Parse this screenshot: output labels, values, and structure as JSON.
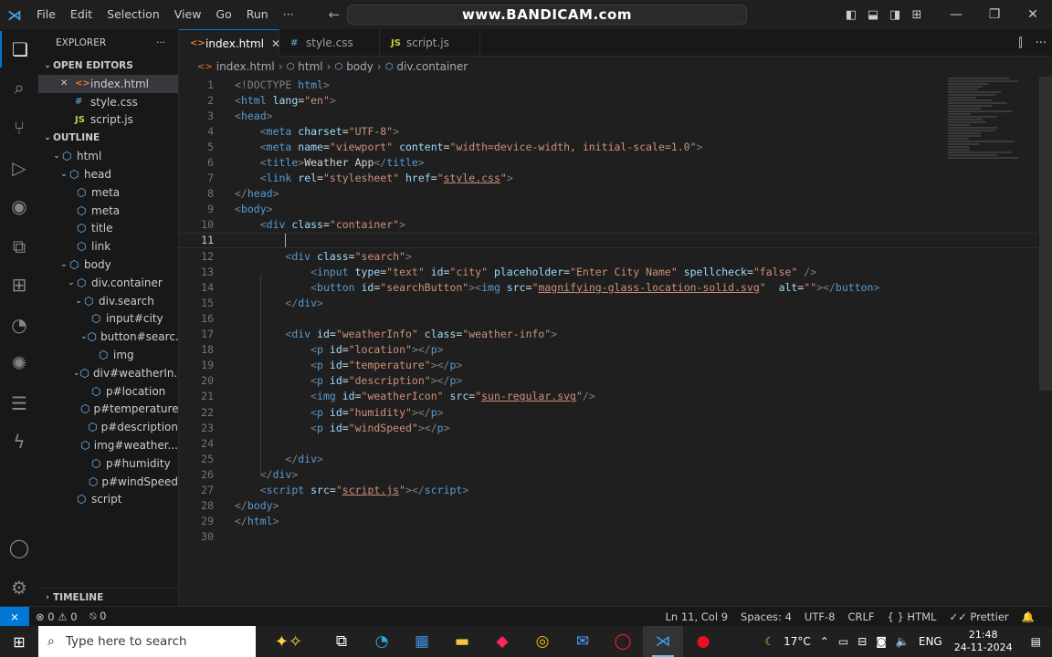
{
  "titlebar": {
    "menu": [
      "File",
      "Edit",
      "Selection",
      "View",
      "Go",
      "Run",
      "···"
    ],
    "search_text": "www.BANDICAM.com"
  },
  "sidebar": {
    "header": "EXPLORER",
    "more": "···",
    "open_editors_label": "OPEN EDITORS",
    "open_editors": [
      {
        "name": "index.html",
        "icon": "<>",
        "color": "#e37933",
        "selected": true
      },
      {
        "name": "style.css",
        "icon": "#",
        "color": "#519aba",
        "selected": false
      },
      {
        "name": "script.js",
        "icon": "JS",
        "color": "#cbcb41",
        "selected": false
      }
    ],
    "outline_label": "OUTLINE",
    "outline": [
      {
        "label": "html",
        "depth": 0,
        "chev": "v"
      },
      {
        "label": "head",
        "depth": 1,
        "chev": "v"
      },
      {
        "label": "meta",
        "depth": 2,
        "chev": ""
      },
      {
        "label": "meta",
        "depth": 2,
        "chev": ""
      },
      {
        "label": "title",
        "depth": 2,
        "chev": ""
      },
      {
        "label": "link",
        "depth": 2,
        "chev": ""
      },
      {
        "label": "body",
        "depth": 1,
        "chev": "v"
      },
      {
        "label": "div.container",
        "depth": 2,
        "chev": "v"
      },
      {
        "label": "div.search",
        "depth": 3,
        "chev": "v"
      },
      {
        "label": "input#city",
        "depth": 4,
        "chev": ""
      },
      {
        "label": "button#searc...",
        "depth": 4,
        "chev": "v"
      },
      {
        "label": "img",
        "depth": 5,
        "chev": ""
      },
      {
        "label": "div#weatherIn...",
        "depth": 3,
        "chev": "v"
      },
      {
        "label": "p#location",
        "depth": 4,
        "chev": ""
      },
      {
        "label": "p#temperature",
        "depth": 4,
        "chev": ""
      },
      {
        "label": "p#description",
        "depth": 4,
        "chev": ""
      },
      {
        "label": "img#weather...",
        "depth": 4,
        "chev": ""
      },
      {
        "label": "p#humidity",
        "depth": 4,
        "chev": ""
      },
      {
        "label": "p#windSpeed",
        "depth": 4,
        "chev": ""
      },
      {
        "label": "script",
        "depth": 2,
        "chev": ""
      }
    ],
    "timeline_label": "TIMELINE"
  },
  "tabs": [
    {
      "name": "index.html",
      "icon": "<>",
      "color": "#e37933",
      "active": true,
      "close": "✕"
    },
    {
      "name": "style.css",
      "icon": "#",
      "color": "#519aba",
      "active": false,
      "close": ""
    },
    {
      "name": "script.js",
      "icon": "JS",
      "color": "#cbcb41",
      "active": false,
      "close": ""
    }
  ],
  "breadcrumb": [
    "index.html",
    "html",
    "body",
    "div.container"
  ],
  "code_lines": [
    [
      [
        "tg",
        "<!DOCTYPE "
      ],
      [
        "tn",
        "html"
      ],
      [
        "tg",
        ">"
      ]
    ],
    [
      [
        "tg",
        "<"
      ],
      [
        "tn",
        "html"
      ],
      [
        "an",
        " lang"
      ],
      [
        "tx",
        "="
      ],
      [
        "av",
        "\"en\""
      ],
      [
        "tg",
        ">"
      ]
    ],
    [
      [
        "tg",
        "<"
      ],
      [
        "tn",
        "head"
      ],
      [
        "tg",
        ">"
      ]
    ],
    [
      [
        "tx",
        "    "
      ],
      [
        "tg",
        "<"
      ],
      [
        "tn",
        "meta"
      ],
      [
        "an",
        " charset"
      ],
      [
        "tx",
        "="
      ],
      [
        "av",
        "\"UTF-8\""
      ],
      [
        "tg",
        ">"
      ]
    ],
    [
      [
        "tx",
        "    "
      ],
      [
        "tg",
        "<"
      ],
      [
        "tn",
        "meta"
      ],
      [
        "an",
        " name"
      ],
      [
        "tx",
        "="
      ],
      [
        "av",
        "\"viewport\""
      ],
      [
        "an",
        " content"
      ],
      [
        "tx",
        "="
      ],
      [
        "av",
        "\"width=device-width, initial-scale=1.0\""
      ],
      [
        "tg",
        ">"
      ]
    ],
    [
      [
        "tx",
        "    "
      ],
      [
        "tg",
        "<"
      ],
      [
        "tn",
        "title"
      ],
      [
        "tg",
        ">"
      ],
      [
        "tx",
        "Weather App"
      ],
      [
        "tg",
        "</"
      ],
      [
        "tn",
        "title"
      ],
      [
        "tg",
        ">"
      ]
    ],
    [
      [
        "tx",
        "    "
      ],
      [
        "tg",
        "<"
      ],
      [
        "tn",
        "link"
      ],
      [
        "an",
        " rel"
      ],
      [
        "tx",
        "="
      ],
      [
        "av",
        "\"stylesheet\""
      ],
      [
        "an",
        " href"
      ],
      [
        "tx",
        "="
      ],
      [
        "av",
        "\""
      ],
      [
        "avu",
        "style.css"
      ],
      [
        "av",
        "\""
      ],
      [
        "tg",
        ">"
      ]
    ],
    [
      [
        "tg",
        "</"
      ],
      [
        "tn",
        "head"
      ],
      [
        "tg",
        ">"
      ]
    ],
    [
      [
        "tg",
        "<"
      ],
      [
        "tn",
        "body"
      ],
      [
        "tg",
        ">"
      ]
    ],
    [
      [
        "tx",
        "    "
      ],
      [
        "tg",
        "<"
      ],
      [
        "tn",
        "div"
      ],
      [
        "an",
        " class"
      ],
      [
        "tx",
        "="
      ],
      [
        "av",
        "\"container\""
      ],
      [
        "tg",
        ">"
      ]
    ],
    [
      [
        "tx",
        "        "
      ],
      [
        "cursor",
        ""
      ]
    ],
    [
      [
        "tx",
        "        "
      ],
      [
        "tg",
        "<"
      ],
      [
        "tn",
        "div"
      ],
      [
        "an",
        " class"
      ],
      [
        "tx",
        "="
      ],
      [
        "av",
        "\"search\""
      ],
      [
        "tg",
        ">"
      ]
    ],
    [
      [
        "tx",
        "            "
      ],
      [
        "tg",
        "<"
      ],
      [
        "tn",
        "input"
      ],
      [
        "an",
        " type"
      ],
      [
        "tx",
        "="
      ],
      [
        "av",
        "\"text\""
      ],
      [
        "an",
        " id"
      ],
      [
        "tx",
        "="
      ],
      [
        "av",
        "\"city\""
      ],
      [
        "an",
        " placeholder"
      ],
      [
        "tx",
        "="
      ],
      [
        "av",
        "\"Enter City Name\""
      ],
      [
        "an",
        " spellcheck"
      ],
      [
        "tx",
        "="
      ],
      [
        "av",
        "\"false\""
      ],
      [
        "tg",
        " />"
      ]
    ],
    [
      [
        "tx",
        "            "
      ],
      [
        "tg",
        "<"
      ],
      [
        "tn",
        "button"
      ],
      [
        "an",
        " id"
      ],
      [
        "tx",
        "="
      ],
      [
        "av",
        "\"searchButton\""
      ],
      [
        "tg",
        "><"
      ],
      [
        "tn",
        "img"
      ],
      [
        "an",
        " src"
      ],
      [
        "tx",
        "="
      ],
      [
        "av",
        "\""
      ],
      [
        "avu",
        "magnifying-glass-location-solid.svg"
      ],
      [
        "av",
        "\""
      ],
      [
        "an",
        "  alt"
      ],
      [
        "tx",
        "="
      ],
      [
        "av",
        "\"\""
      ],
      [
        "tg",
        "></"
      ],
      [
        "tn",
        "button"
      ],
      [
        "tg",
        ">"
      ]
    ],
    [
      [
        "tx",
        "        "
      ],
      [
        "tg",
        "</"
      ],
      [
        "tn",
        "div"
      ],
      [
        "tg",
        ">"
      ]
    ],
    [],
    [
      [
        "tx",
        "        "
      ],
      [
        "tg",
        "<"
      ],
      [
        "tn",
        "div"
      ],
      [
        "an",
        " id"
      ],
      [
        "tx",
        "="
      ],
      [
        "av",
        "\"weatherInfo\""
      ],
      [
        "an",
        " class"
      ],
      [
        "tx",
        "="
      ],
      [
        "av",
        "\"weather-info\""
      ],
      [
        "tg",
        ">"
      ]
    ],
    [
      [
        "tx",
        "            "
      ],
      [
        "tg",
        "<"
      ],
      [
        "tn",
        "p"
      ],
      [
        "an",
        " id"
      ],
      [
        "tx",
        "="
      ],
      [
        "av",
        "\"location\""
      ],
      [
        "tg",
        "></"
      ],
      [
        "tn",
        "p"
      ],
      [
        "tg",
        ">"
      ]
    ],
    [
      [
        "tx",
        "            "
      ],
      [
        "tg",
        "<"
      ],
      [
        "tn",
        "p"
      ],
      [
        "an",
        " id"
      ],
      [
        "tx",
        "="
      ],
      [
        "av",
        "\"temperature\""
      ],
      [
        "tg",
        "></"
      ],
      [
        "tn",
        "p"
      ],
      [
        "tg",
        ">"
      ]
    ],
    [
      [
        "tx",
        "            "
      ],
      [
        "tg",
        "<"
      ],
      [
        "tn",
        "p"
      ],
      [
        "an",
        " id"
      ],
      [
        "tx",
        "="
      ],
      [
        "av",
        "\"description\""
      ],
      [
        "tg",
        "></"
      ],
      [
        "tn",
        "p"
      ],
      [
        "tg",
        ">"
      ]
    ],
    [
      [
        "tx",
        "            "
      ],
      [
        "tg",
        "<"
      ],
      [
        "tn",
        "img"
      ],
      [
        "an",
        " id"
      ],
      [
        "tx",
        "="
      ],
      [
        "av",
        "\"weatherIcon\""
      ],
      [
        "an",
        " src"
      ],
      [
        "tx",
        "="
      ],
      [
        "av",
        "\""
      ],
      [
        "avu",
        "sun-regular.svg"
      ],
      [
        "av",
        "\""
      ],
      [
        "tg",
        "/>"
      ]
    ],
    [
      [
        "tx",
        "            "
      ],
      [
        "tg",
        "<"
      ],
      [
        "tn",
        "p"
      ],
      [
        "an",
        " id"
      ],
      [
        "tx",
        "="
      ],
      [
        "av",
        "\"humidity\""
      ],
      [
        "tg",
        "></"
      ],
      [
        "tn",
        "p"
      ],
      [
        "tg",
        ">"
      ]
    ],
    [
      [
        "tx",
        "            "
      ],
      [
        "tg",
        "<"
      ],
      [
        "tn",
        "p"
      ],
      [
        "an",
        " id"
      ],
      [
        "tx",
        "="
      ],
      [
        "av",
        "\"windSpeed\""
      ],
      [
        "tg",
        "></"
      ],
      [
        "tn",
        "p"
      ],
      [
        "tg",
        ">"
      ]
    ],
    [],
    [
      [
        "tx",
        "        "
      ],
      [
        "tg",
        "</"
      ],
      [
        "tn",
        "div"
      ],
      [
        "tg",
        ">"
      ]
    ],
    [
      [
        "tx",
        "    "
      ],
      [
        "tg",
        "</"
      ],
      [
        "tn",
        "div"
      ],
      [
        "tg",
        ">"
      ]
    ],
    [
      [
        "tx",
        "    "
      ],
      [
        "tg",
        "<"
      ],
      [
        "tn",
        "script"
      ],
      [
        "an",
        " src"
      ],
      [
        "tx",
        "="
      ],
      [
        "av",
        "\""
      ],
      [
        "avu",
        "script.js"
      ],
      [
        "av",
        "\""
      ],
      [
        "tg",
        "></"
      ],
      [
        "tn",
        "script"
      ],
      [
        "tg",
        ">"
      ]
    ],
    [
      [
        "tg",
        "</"
      ],
      [
        "tn",
        "body"
      ],
      [
        "tg",
        ">"
      ]
    ],
    [
      [
        "tg",
        "</"
      ],
      [
        "tn",
        "html"
      ],
      [
        "tg",
        ">"
      ]
    ],
    []
  ],
  "current_line": 11,
  "statusbar": {
    "remote_icon": "⨯",
    "problems": "⊗ 0 ⚠ 0",
    "ports": "⍉ 0",
    "position": "Ln 11, Col 9",
    "spaces": "Spaces: 4",
    "encoding": "UTF-8",
    "eol": "CRLF",
    "language": "{ } HTML",
    "prettier": "✓✓ Prettier",
    "bell": "🔔"
  },
  "taskbar": {
    "search_placeholder": "Type here to search",
    "weather": "17°C",
    "lang": "ENG",
    "time": "21:48",
    "date": "24-11-2024"
  }
}
